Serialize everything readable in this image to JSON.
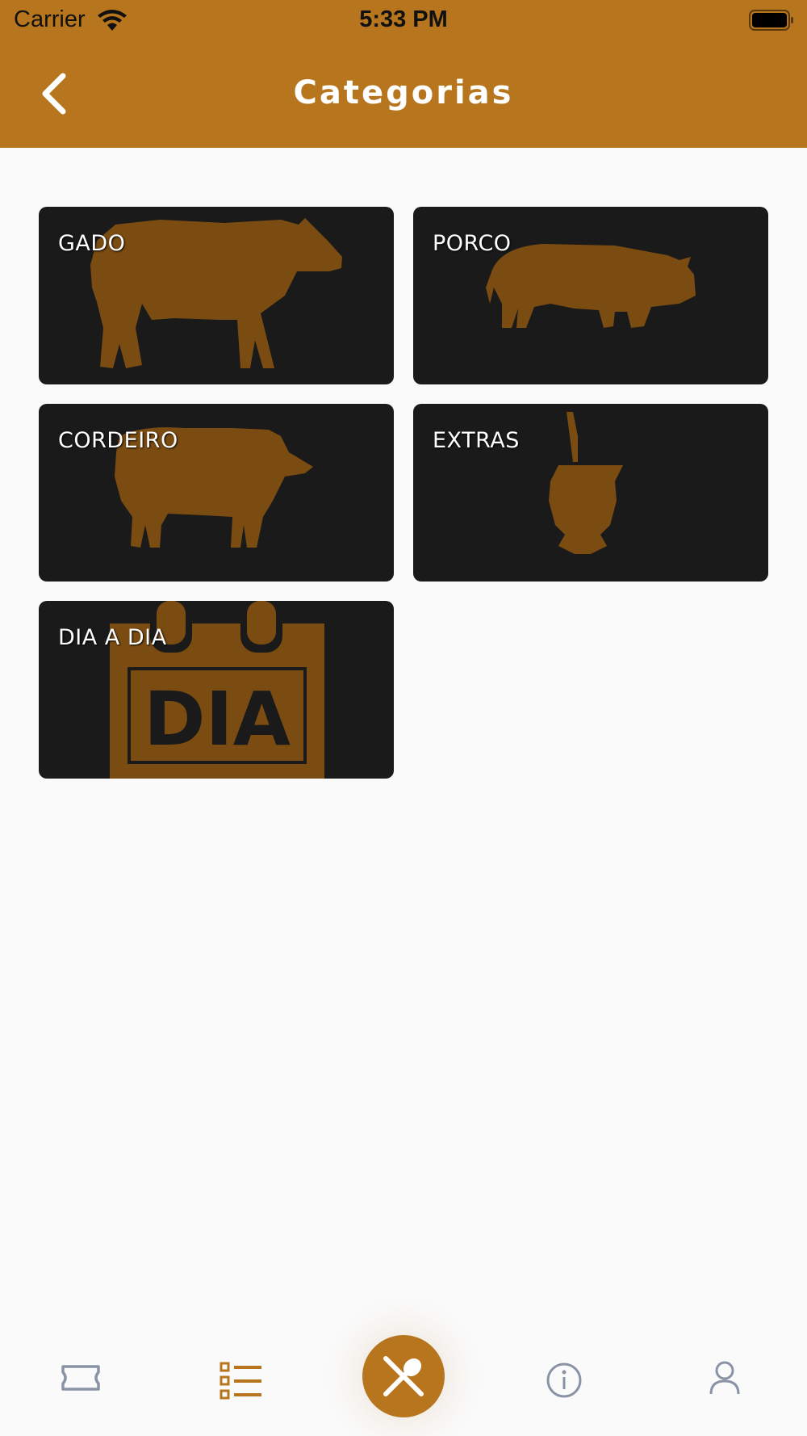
{
  "status_bar": {
    "carrier": "Carrier",
    "time": "5:33 PM"
  },
  "header": {
    "title": "Categorias",
    "back_icon": "chevron-left-icon"
  },
  "categories": [
    {
      "label": "GADO",
      "icon": "cow-icon"
    },
    {
      "label": "PORCO",
      "icon": "pig-icon"
    },
    {
      "label": "CORDEIRO",
      "icon": "sheep-icon"
    },
    {
      "label": "EXTRAS",
      "icon": "chimarrao-cup-icon"
    },
    {
      "label": "DIA A DIA",
      "icon": "calendar-dia-icon",
      "icon_text": "DIA"
    }
  ],
  "tab_bar": {
    "items": [
      {
        "icon": "ticket-icon",
        "active": false
      },
      {
        "icon": "list-icon",
        "active": true
      },
      {
        "icon": "fork-spoon-icon",
        "active": true
      },
      {
        "icon": "info-icon",
        "active": false
      },
      {
        "icon": "user-icon",
        "active": false
      }
    ]
  },
  "colors": {
    "accent": "#b7751d",
    "card_background": "#1a1a1a",
    "silhouette": "#7b4c12",
    "page_background": "#fafafa",
    "inactive_icon": "#8a93a6"
  }
}
